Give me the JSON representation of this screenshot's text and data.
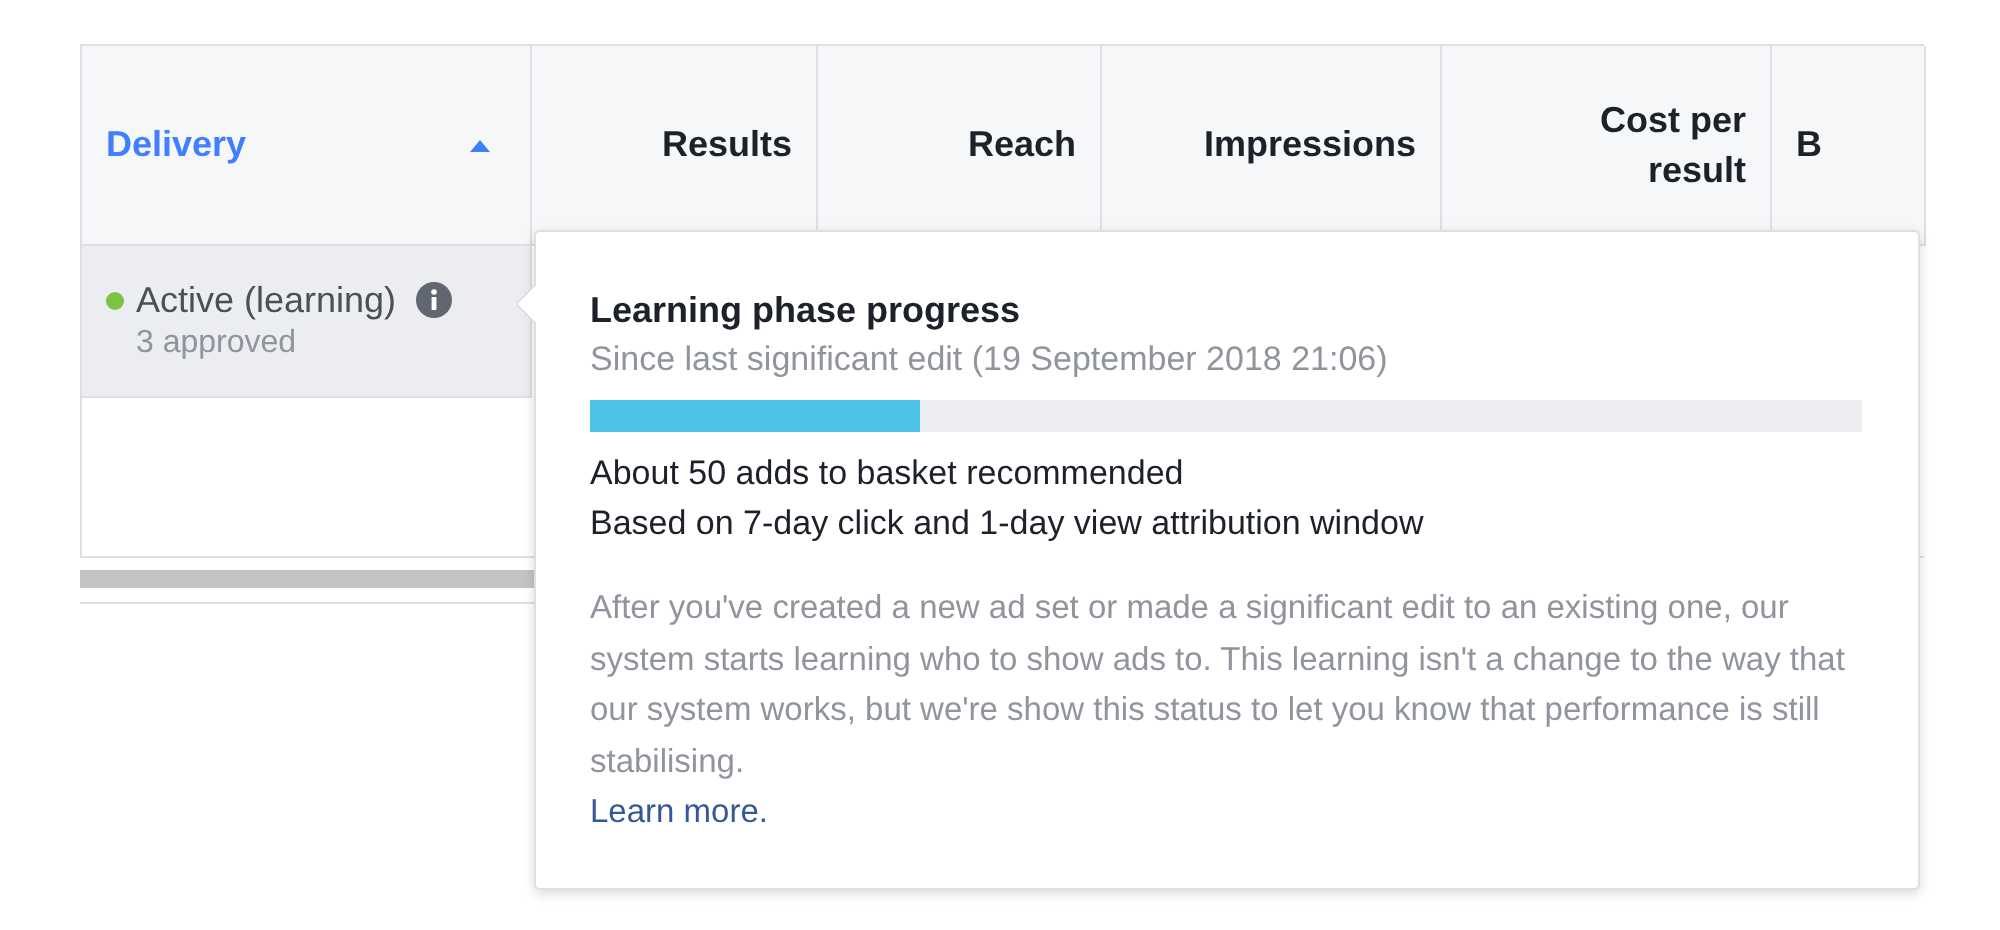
{
  "table": {
    "columns": [
      {
        "label": "Delivery",
        "sorted": true
      },
      {
        "label": "Results",
        "sorted": false
      },
      {
        "label": "Reach",
        "sorted": false
      },
      {
        "label": "Impressions",
        "sorted": false
      },
      {
        "label": "Cost per result",
        "sorted": false
      },
      {
        "label": "B",
        "sorted": false
      }
    ],
    "rows": [
      {
        "status": "Active (learning)",
        "color": "#7dc242",
        "detail": "3 approved"
      }
    ]
  },
  "popover": {
    "title": "Learning phase progress",
    "subtitle": "Since last significant edit (19 September 2018 21:06)",
    "level": 0.26,
    "lines": [
      "About 50 adds to basket recommended",
      "Based on 7-day click and 1-day view attribution window"
    ],
    "body": "After you've created a new ad set or made a significant edit to an existing one, our system starts learning who to show ads to. This learning isn't a change to the way that our system works, but we're show this status to let you know that performance is still stabilising.",
    "link": "Learn more."
  }
}
